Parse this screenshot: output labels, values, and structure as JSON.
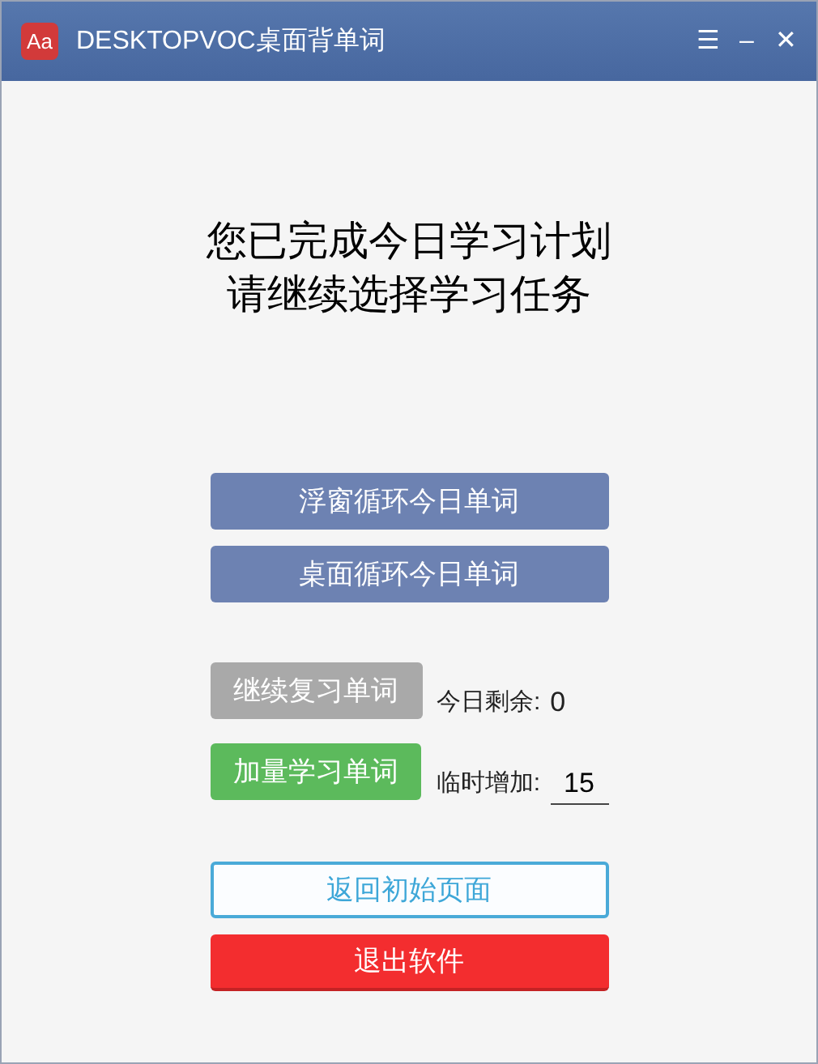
{
  "window": {
    "logo": "Aa",
    "title": "DESKTOPVOC桌面背单词",
    "controls": [
      "☰",
      "–",
      "✕"
    ]
  },
  "message": [
    "您已完成今日学习计划",
    "请继续选择学习任务"
  ],
  "loop_buttons": [
    {
      "label": "浮窗循环今日单词",
      "kind": "primary"
    },
    {
      "label": "桌面循环今日单词",
      "kind": "primary"
    }
  ],
  "study": [
    {
      "button": {
        "label": "继续复习单词",
        "disabled": true
      },
      "label": "今日剩余:",
      "value": "0",
      "kind": "readout"
    },
    {
      "button": {
        "label": "加量学习单词",
        "disabled": false
      },
      "label": "临时增加:",
      "value": "15",
      "kind": "input"
    }
  ],
  "bottom_buttons": [
    {
      "label": "返回初始页面",
      "kind": "outline"
    },
    {
      "label": "退出软件",
      "kind": "danger"
    }
  ]
}
